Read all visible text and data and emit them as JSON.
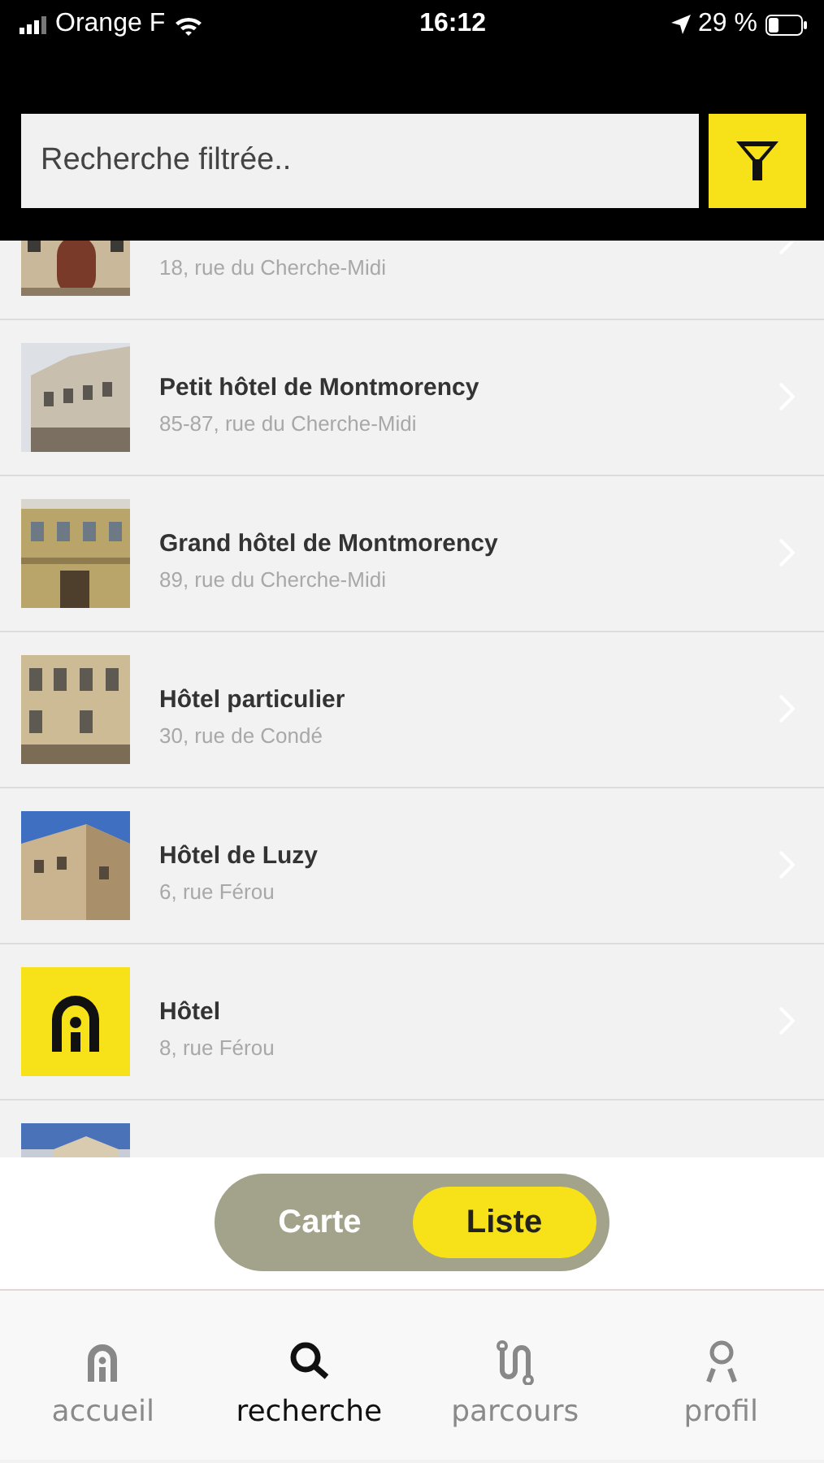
{
  "status_bar": {
    "carrier": "Orange F",
    "time": "16:12",
    "battery": "29 %"
  },
  "search": {
    "placeholder": "Recherche filtrée.."
  },
  "results": [
    {
      "kind": "picture",
      "address": "18, rue du Cherche-Midi"
    },
    {
      "kind": "picture",
      "title": "Petit hôtel de Montmorency",
      "address": "85-87, rue du Cherche-Midi"
    },
    {
      "kind": "picture",
      "title": "Grand hôtel de Montmorency",
      "address": "89, rue du Cherche-Midi"
    },
    {
      "kind": "picture",
      "title": "Hôtel particulier",
      "address": "30, rue de Condé"
    },
    {
      "kind": "picture",
      "title": "Hôtel de Luzy",
      "address": "6, rue Férou"
    },
    {
      "kind": "logo",
      "title": "Hôtel",
      "address": "8, rue Férou"
    },
    {
      "kind": "picture"
    }
  ],
  "view_toggle": [
    {
      "label": "Carte",
      "selected": false
    },
    {
      "label": "Liste",
      "selected": true
    }
  ],
  "tab_bar": [
    {
      "label": "accueil",
      "selected": false
    },
    {
      "label": "recherche",
      "selected": true
    },
    {
      "label": "parcours",
      "selected": false
    },
    {
      "label": "profil",
      "selected": false
    }
  ]
}
